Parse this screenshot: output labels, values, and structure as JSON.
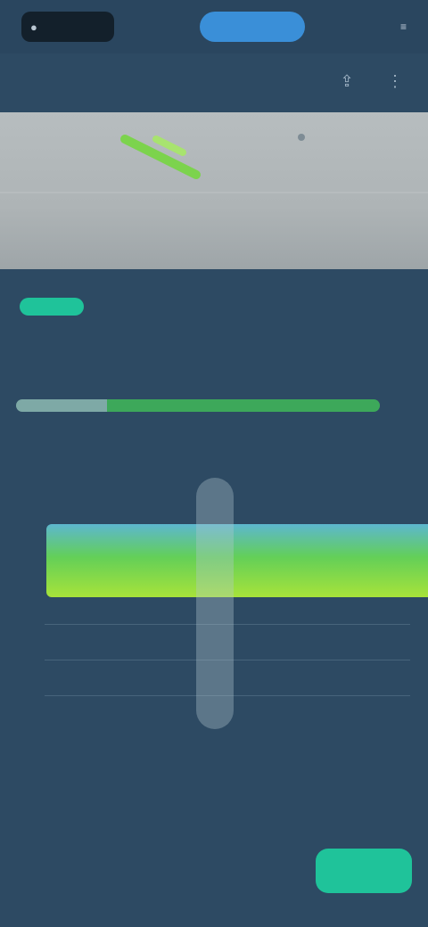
{
  "topbar": {
    "left_label": "",
    "center_label": "",
    "right_label": ""
  },
  "subheader": {
    "title": ""
  },
  "chips": [
    {
      "label": ""
    },
    {
      "label": ""
    },
    {
      "label": ""
    },
    {
      "label": ""
    }
  ],
  "days": [
    "",
    "",
    "",
    "",
    "",
    ""
  ],
  "scale": {
    "left": "",
    "right": ""
  },
  "hours": [
    "",
    "",
    "",
    "",
    "",
    "",
    "",
    "",
    "",
    "",
    ""
  ],
  "band": {
    "labels": [
      "",
      ""
    ]
  },
  "y_label": "",
  "footer": {
    "text": "",
    "sub": ""
  },
  "bottom": {
    "note": "",
    "button_label": ""
  },
  "colors": {
    "accent": "#1fc39a",
    "primary_blue": "#3a8fd8",
    "background": "#2d4a63"
  },
  "timeline": {
    "progress_a": 0.25,
    "progress_b": 0.75
  }
}
